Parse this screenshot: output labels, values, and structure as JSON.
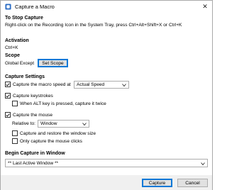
{
  "window": {
    "title": "Capture a Macro"
  },
  "stop_capture": {
    "heading": "To Stop Capture",
    "instruction": "Right-click on the Recording Icon in the System Tray, press Ctrl+Alt+Shift+X or Ctrl+K"
  },
  "activation": {
    "heading": "Activation",
    "value": "Ctrl+K"
  },
  "scope": {
    "heading": "Scope",
    "value": "Global Except",
    "button_label": "Set Scope"
  },
  "capture_settings": {
    "heading": "Capture Settings",
    "macro_speed_label": "Capture the macro speed at",
    "macro_speed_checked": true,
    "speed_value": "Actual Speed",
    "keystrokes_label": "Capture keystrokes",
    "keystrokes_checked": true,
    "alt_key_label": "When ALT key is pressed, capture it twice",
    "alt_key_checked": false,
    "mouse_label": "Capture the mouse",
    "mouse_checked": true,
    "relative_to_label": "Relative to:",
    "relative_to_value": "Window",
    "restore_window_label": "Capture and restore the window size",
    "restore_window_checked": false,
    "only_clicks_label": "Only capture the mouse clicks",
    "only_clicks_checked": false
  },
  "begin_capture": {
    "heading": "Begin Capture in Window",
    "window_value": "** Last Active Window **"
  },
  "footer": {
    "capture_label": "Capture",
    "cancel_label": "Cancel"
  },
  "colors": {
    "accent": "#0078d7",
    "footer_bg": "#f0f0f0",
    "button_bg": "#e1e1e1"
  }
}
